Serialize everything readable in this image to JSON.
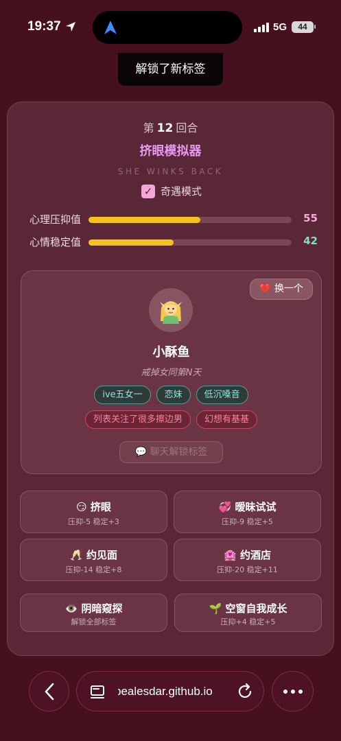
{
  "status_bar": {
    "time": "19:37",
    "network": "5G",
    "battery": "44"
  },
  "toast": "解锁了新标签",
  "game": {
    "round_prefix": "第",
    "round_number": "12",
    "round_suffix": "回合",
    "title": "挤眼模拟器",
    "subtitle": "SHE WINKS BACK",
    "mode_label": "奇遇模式",
    "mode_checked": true
  },
  "stats": [
    {
      "label": "心理压抑值",
      "value": "55",
      "fill_fraction": 0.55,
      "value_color": "#f5a9d4"
    },
    {
      "label": "心情稳定值",
      "value": "42",
      "fill_fraction": 0.42,
      "value_color": "#7fe0c8"
    }
  ],
  "character": {
    "swap_label": "换一个",
    "swap_icon": "broken-heart-icon",
    "avatar_icon": "woman-elf-emoji",
    "name": "小酥鱼",
    "description": "戒掉女同第N天",
    "tags_green": [
      "ive五女一",
      "恋妹",
      "低沉嗓音"
    ],
    "tags_red": [
      "列表关注了很多擦边男",
      "幻想有基基"
    ],
    "chat_label": "聊天解锁标签",
    "chat_icon": "speech-bubble-icon"
  },
  "actions": [
    {
      "emoji": "😏",
      "label": "挤眼",
      "effect": "压抑-5 稳定+3"
    },
    {
      "emoji": "💞",
      "label": "暧昧试试",
      "effect": "压抑-9 稳定+5"
    },
    {
      "emoji": "🥂",
      "label": "约见面",
      "effect": "压抑-14 稳定+8"
    },
    {
      "emoji": "🏩",
      "label": "约酒店",
      "effect": "压抑-20 稳定+11"
    },
    {
      "emoji": "👁️",
      "label": "阴暗窥探",
      "effect": "解锁全部标签"
    },
    {
      "emoji": "🌱",
      "label": "空窗自我成长",
      "effect": "压抑+4 稳定+5"
    }
  ],
  "browser": {
    "url": "pealesdar.github.io"
  }
}
